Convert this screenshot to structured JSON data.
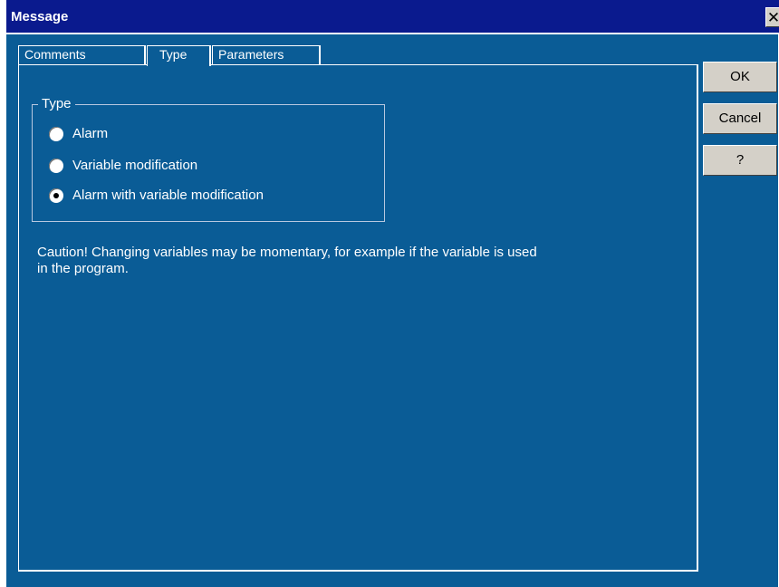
{
  "window": {
    "title": "Message",
    "close_glyph": "✕"
  },
  "tabs": [
    {
      "label": "Comments",
      "active": false
    },
    {
      "label": "Type",
      "active": true
    },
    {
      "label": "Parameters",
      "active": false
    }
  ],
  "type_group": {
    "title": "Type",
    "options": [
      {
        "label": "Alarm",
        "selected": false
      },
      {
        "label": "Variable modification",
        "selected": false
      },
      {
        "label": "Alarm with variable modification",
        "selected": true
      }
    ]
  },
  "caution_text": "Caution! Changing variables may be momentary, for example if the variable is used in the program.",
  "buttons": {
    "ok": "OK",
    "cancel": "Cancel",
    "help": "?"
  },
  "colors": {
    "window_bg": "#0a5c96",
    "titlebar_bg": "#0a1a8e",
    "button_face": "#d4d0c8",
    "text": "#ffffff"
  },
  "icons": {
    "close": "close-icon",
    "radio": "radio-button-icon"
  }
}
